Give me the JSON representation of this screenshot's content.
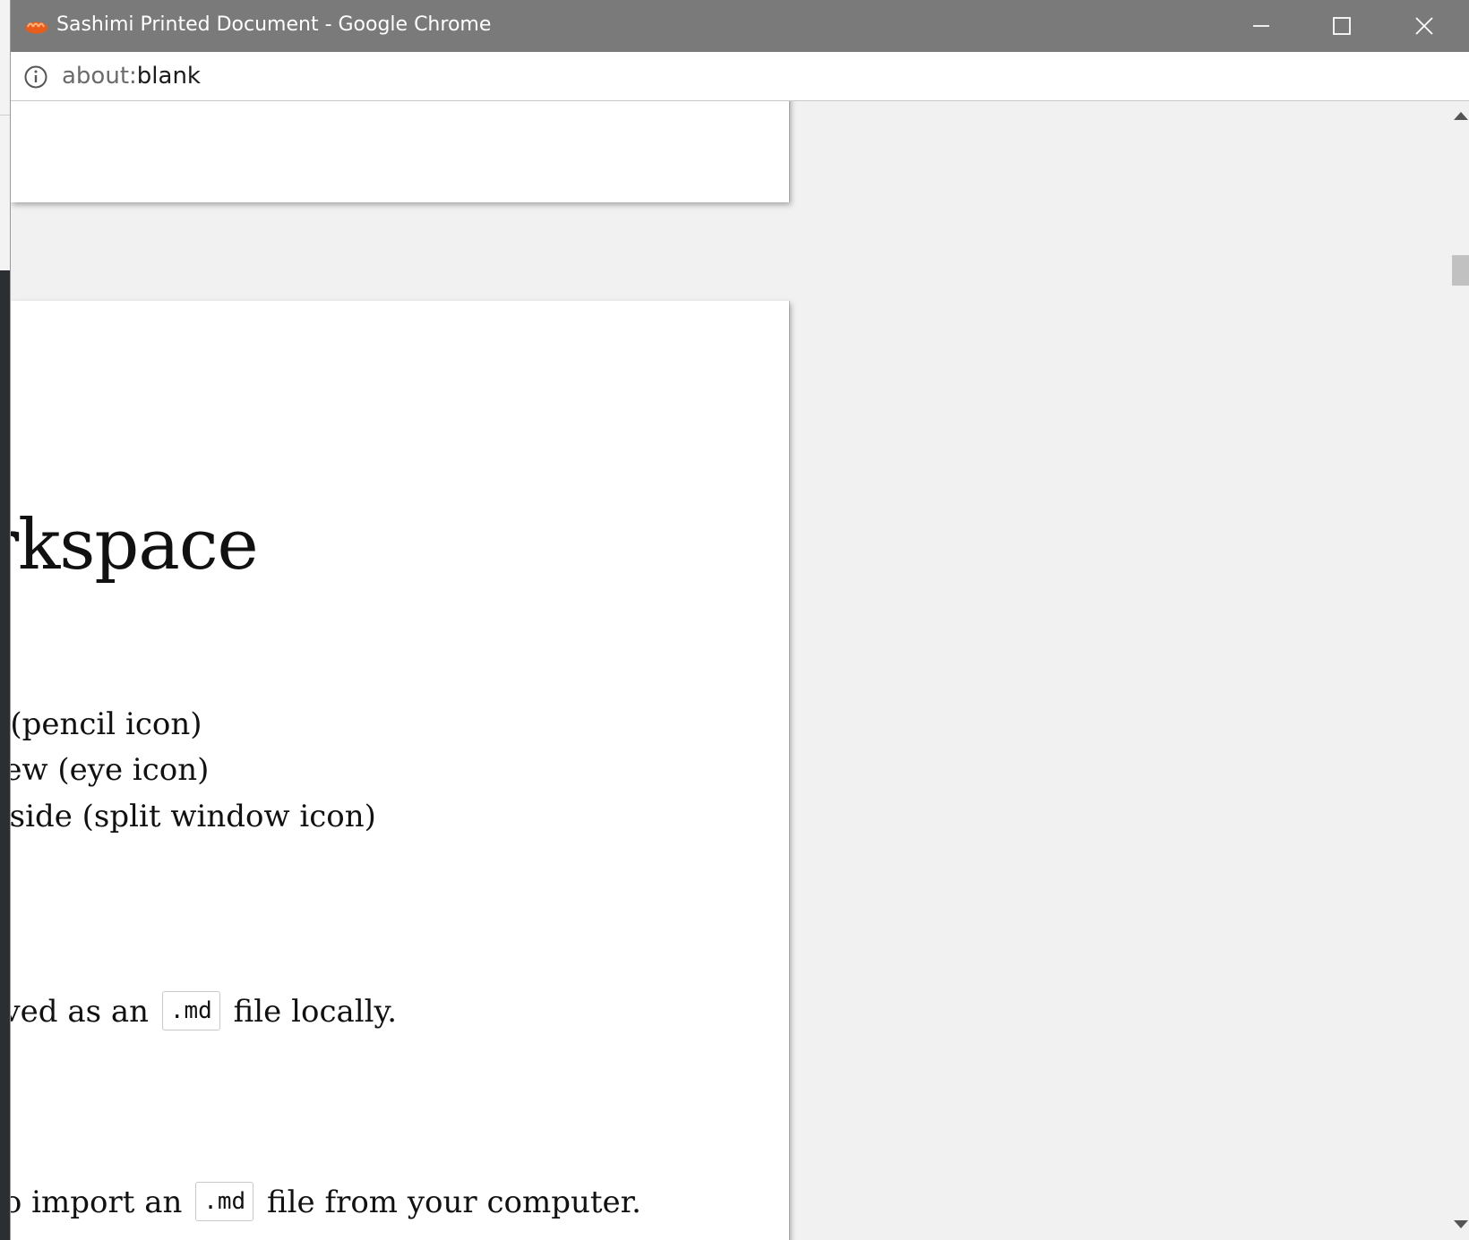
{
  "window": {
    "title": "Sashimi Printed Document - Google Chrome",
    "url_scheme": "about:",
    "url_path": "blank"
  },
  "document": {
    "heading": "Workspace",
    "list_items": [
      "Edit mode (pencil icon)",
      "Preview (eye icon)",
      "Side by side (split window icon)"
    ],
    "paragraph_save": {
      "before": "Notes are saved as an",
      "code": ".md",
      "after": "file locally."
    },
    "paragraph_import": {
      "before": "Click to import an",
      "code": ".md",
      "after": "file from your computer."
    }
  },
  "colors": {
    "titlebar": "#7a7a7a",
    "viewport_bg": "#f1f1f1",
    "app_icon": "#f26b2a"
  },
  "icons": {
    "app": "sashimi-icon",
    "info": "info-icon",
    "minimize": "minimize-icon",
    "maximize": "maximize-icon",
    "close": "close-icon"
  }
}
